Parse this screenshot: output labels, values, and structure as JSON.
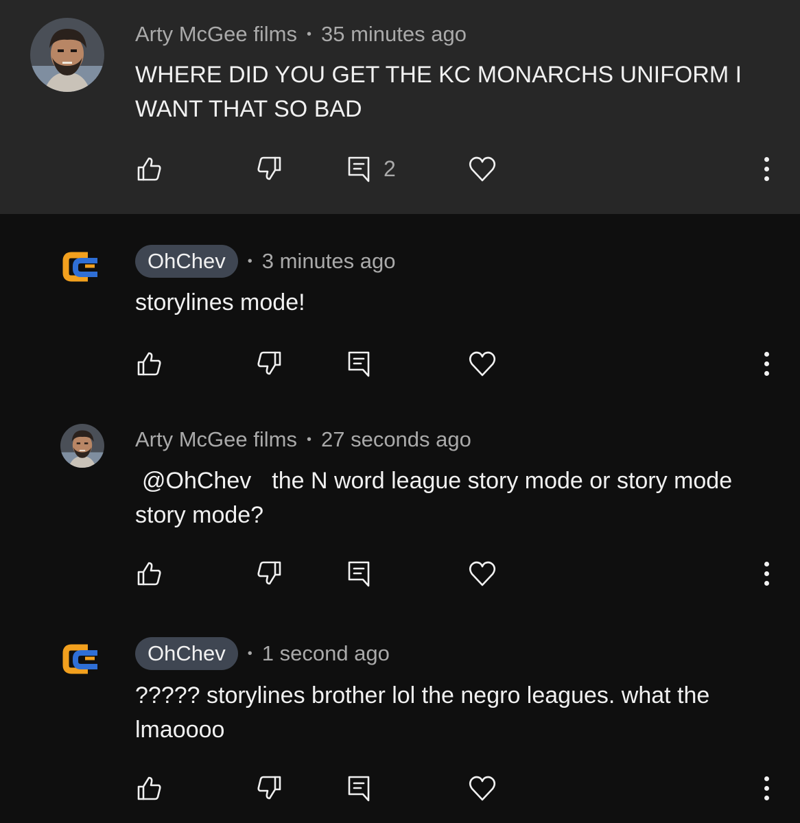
{
  "comments": [
    {
      "author": "Arty McGee films",
      "time": "35 minutes ago",
      "text": "WHERE DID YOU GET THE KC MONARCHS UNIFORM I WANT THAT SO BAD",
      "reply_count": "2",
      "avatar_icon": "user-photo-avatar"
    },
    {
      "author": "OhChev",
      "time": "3 minutes ago",
      "text": "storylines mode!",
      "avatar_icon": "oc-logo-avatar"
    },
    {
      "author": "Arty McGee films",
      "time": "27 seconds ago",
      "mention": "@OhChev",
      "text": "the N word league story mode or story mode story mode?",
      "avatar_icon": "user-photo-avatar"
    },
    {
      "author": "OhChev",
      "time": "1 second ago",
      "text": "????? storylines brother lol the negro leagues. what the lmaoooo",
      "avatar_icon": "oc-logo-avatar"
    }
  ],
  "icons": {
    "like": "thumbs-up-icon",
    "dislike": "thumbs-down-icon",
    "reply": "reply-icon",
    "heart": "heart-icon",
    "more": "more-vertical-icon"
  },
  "colors": {
    "top_comment_bg": "#272727",
    "page_bg": "#0f0f0f",
    "creator_pill": "#3f4652",
    "logo_orange": "#f2a01e",
    "logo_blue": "#2f6fd6"
  },
  "separator": "•"
}
